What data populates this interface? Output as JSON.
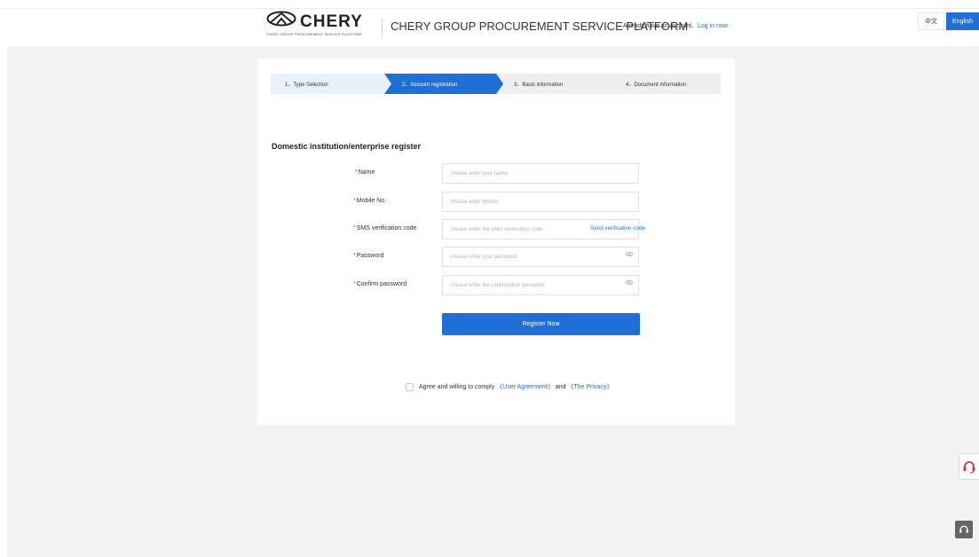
{
  "header": {
    "logo_text": "CHERY",
    "logo_subtext": "CHERY GROUP PROCUREMENT SERVICE PLATFORM",
    "platform_title": "CHERY GROUP PROCUREMENT SERVICE PLATFORM",
    "account_prompt": "Already have an account,",
    "login_link": "Log in now"
  },
  "language": {
    "chinese": "中文",
    "english": "English",
    "active": "English"
  },
  "steps": [
    {
      "label": "1、Type Selection",
      "state": "done"
    },
    {
      "label": "2、Account registration",
      "state": "active"
    },
    {
      "label": "3、Basic information",
      "state": "pending"
    },
    {
      "label": "4、Document information",
      "state": "pending"
    }
  ],
  "form": {
    "heading": "Domestic institution/enterprise register",
    "required_mark": "*",
    "fields": [
      {
        "label": "Name",
        "placeholder": "Please enter your name",
        "value": ""
      },
      {
        "label": "Mobile No.",
        "placeholder": "Please enter Mobile",
        "value": ""
      },
      {
        "label": "SMS verification code",
        "placeholder": "Please enter the SMS verification code",
        "value": ""
      },
      {
        "label": "Password",
        "placeholder": "Please enter your password",
        "value": ""
      },
      {
        "label": "Confirm password",
        "placeholder": "Please enter the confirmation password",
        "value": ""
      }
    ],
    "send_code_label": "Send verification code",
    "submit_label": "Register Now"
  },
  "agreement": {
    "text_before": "Agree and willing to comply",
    "user_agreement": "《User Agreement》",
    "and": "and",
    "privacy": "《The Privacy》",
    "checked": false
  },
  "colors": {
    "accent": "#1f6fd6",
    "required": "#e04a3a",
    "page_background": "#f2f2f2",
    "support_icon": "#d9302c"
  },
  "icons": {
    "password_toggle": "eye-icon",
    "support": "headset-icon"
  }
}
